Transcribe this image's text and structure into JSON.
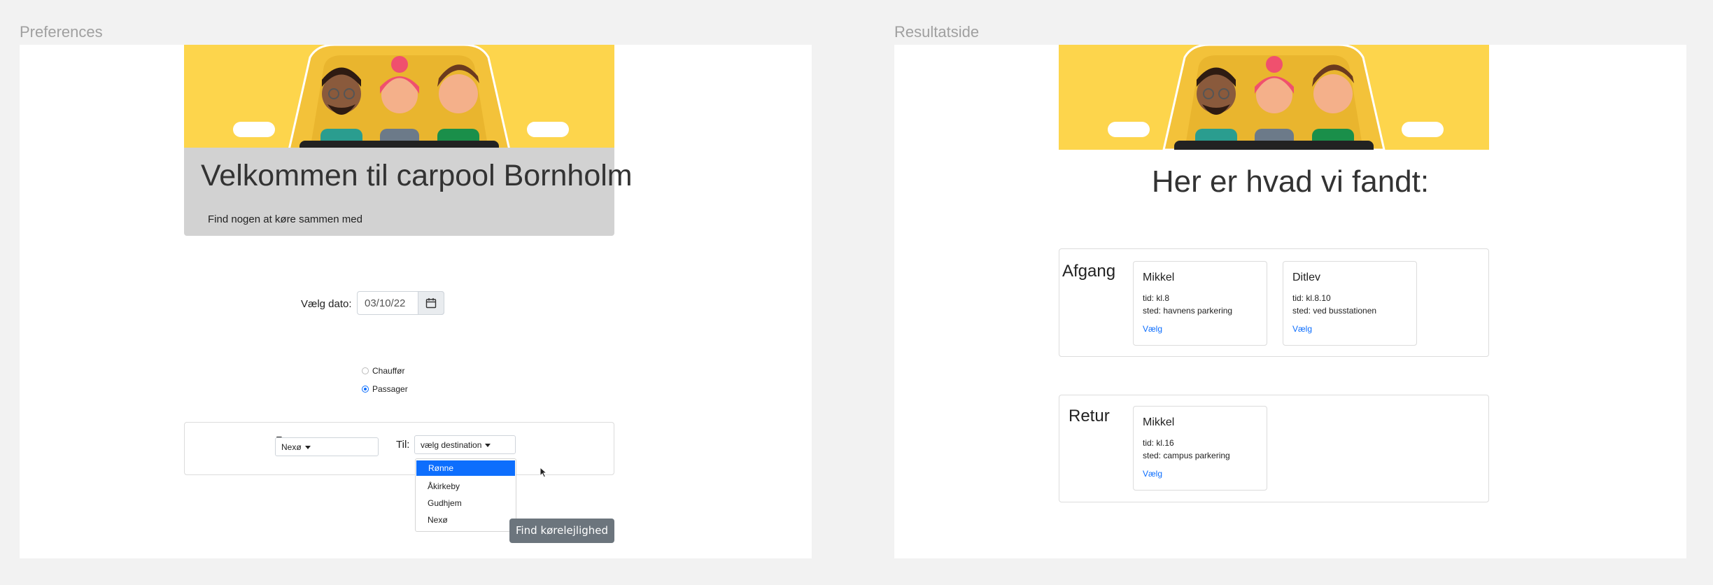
{
  "frames": {
    "left_label": "Preferences",
    "right_label": "Resultatside"
  },
  "preferences": {
    "title": "Velkommen til carpool Bornholm",
    "subtitle": "Find nogen at køre sammen med",
    "date_label": "Vælg dato:",
    "date_value": "03/10/22",
    "roles": [
      {
        "label": "Chauffør",
        "checked": false
      },
      {
        "label": "Passager",
        "checked": true
      }
    ],
    "from_label": "Fra:",
    "from_value": "Nexø",
    "to_label": "Til:",
    "to_value": "vælg destination",
    "destinations": [
      {
        "label": "Rønne",
        "highlighted": true
      },
      {
        "label": "Åkirkeby",
        "highlighted": false
      },
      {
        "label": "Gudhjem",
        "highlighted": false
      },
      {
        "label": "Nexø",
        "highlighted": false
      }
    ],
    "find_button": "Find kørelejlighed"
  },
  "results": {
    "title": "Her er hvad vi fandt:",
    "departure": {
      "title": "Afgang",
      "cards": [
        {
          "name": "Mikkel",
          "tid": "tid: kl.8",
          "sted": "sted: havnens parkering",
          "link": "Vælg"
        },
        {
          "name": "Ditlev",
          "tid": "tid: kl.8.10",
          "sted": "sted: ved busstationen",
          "link": "Vælg"
        }
      ]
    },
    "return": {
      "title": "Retur",
      "cards": [
        {
          "name": "Mikkel",
          "tid": "tid: kl.16",
          "sted": "sted: campus parkering",
          "link": "Vælg"
        }
      ]
    }
  },
  "colors": {
    "banner_yellow": "#fdd54c",
    "primary_blue": "#0d6efd",
    "button_gray": "#6c757d",
    "jumbotron_gray": "#d2d2d2"
  },
  "icons": [
    "calendar-icon",
    "caret-down-icon",
    "cursor-icon"
  ]
}
